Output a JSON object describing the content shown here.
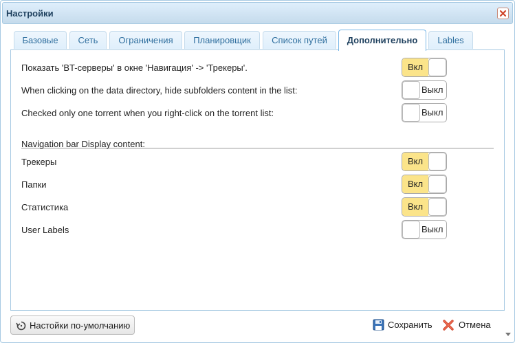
{
  "window": {
    "title": "Настройки"
  },
  "tabs": [
    {
      "label": "Базовые",
      "active": false
    },
    {
      "label": "Сеть",
      "active": false
    },
    {
      "label": "Ограничения",
      "active": false
    },
    {
      "label": "Планировщик",
      "active": false
    },
    {
      "label": "Список путей",
      "active": false
    },
    {
      "label": "Дополнительно",
      "active": true
    },
    {
      "label": "Lables",
      "active": false
    }
  ],
  "options": [
    {
      "label": "Показать 'BT-серверы' в окне 'Навигация' -> 'Трекеры'.",
      "state": "on"
    },
    {
      "label": "When clicking on the data directory, hide subfolders content in the list:",
      "state": "off"
    },
    {
      "label": "Checked only one torrent when you right-click on the torrent list:",
      "state": "off"
    }
  ],
  "navigation": {
    "heading": "Navigation bar Display content:",
    "items": [
      {
        "label": "Трекеры",
        "state": "on"
      },
      {
        "label": "Папки",
        "state": "on"
      },
      {
        "label": "Статистика",
        "state": "on"
      },
      {
        "label": "User Labels",
        "state": "off"
      }
    ]
  },
  "toggle_labels": {
    "on": "Вкл",
    "off": "Выкл"
  },
  "footer": {
    "default_button": "Настойки по-умолчанию",
    "save_button": "Сохранить",
    "cancel_button": "Отмена"
  },
  "colors": {
    "toggle_on": "#fbe48a",
    "accent": "#2e6e9e",
    "title_bar": "#dfeffc"
  },
  "icons": {
    "close": "close-icon",
    "reset": "reset-icon",
    "save": "save-icon",
    "cancel": "cancel-icon"
  }
}
